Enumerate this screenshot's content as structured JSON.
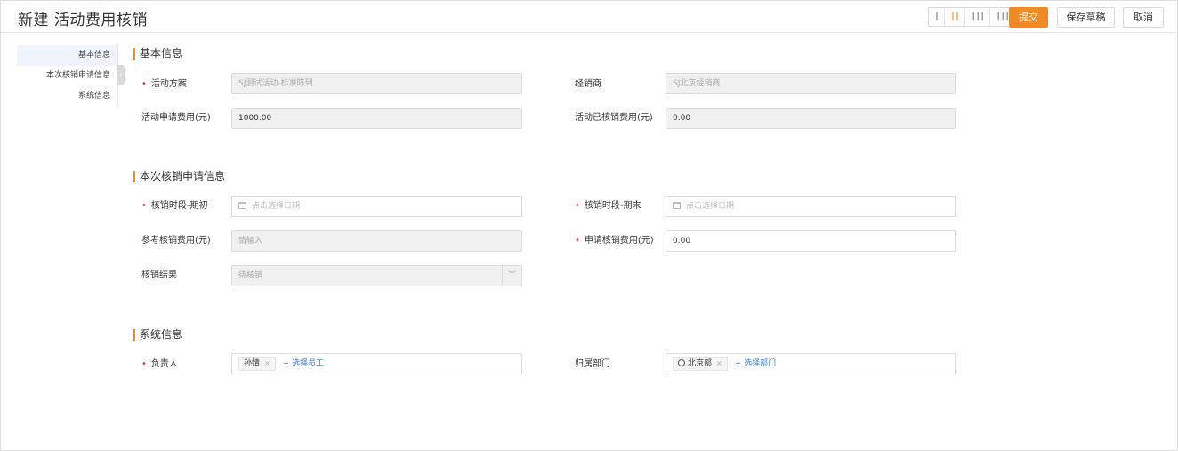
{
  "header": {
    "title": "新建 活动费用核销",
    "layout_options": [
      "|",
      "||",
      "|||",
      "||||"
    ],
    "submit_label": "提交",
    "save_draft_label": "保存草稿",
    "cancel_label": "取消"
  },
  "sidebar": {
    "items": [
      {
        "label": "基本信息"
      },
      {
        "label": "本次核销申请信息"
      },
      {
        "label": "系统信息"
      }
    ]
  },
  "sections": {
    "basic": {
      "title": "基本信息",
      "activity_plan_label": "活动方案",
      "activity_plan_value": "SJ测试活动-标准陈列",
      "dealer_label": "经销商",
      "dealer_value": "SJ北京经销商",
      "apply_fee_label": "活动申请费用(元)",
      "apply_fee_value": "1000.00",
      "written_off_label": "活动已核销费用(元)",
      "written_off_value": "0.00"
    },
    "current": {
      "title": "本次核销申请信息",
      "period_start_label": "核销时段-期初",
      "period_start_placeholder": "点击选择日期",
      "period_end_label": "核销时段-期末",
      "period_end_placeholder": "点击选择日期",
      "ref_fee_label": "参考核销费用(元)",
      "ref_fee_placeholder": "请输入",
      "request_fee_label": "申请核销费用(元)",
      "request_fee_value": "0.00",
      "result_label": "核销结果",
      "result_value": "待核销"
    },
    "system": {
      "title": "系统信息",
      "owner_label": "负责人",
      "owner_tag": "孙婧",
      "owner_add": "+ 选择员工",
      "dept_label": "归属部门",
      "dept_tag": "北京部",
      "dept_add": "+ 选择部门",
      "tag_remove": "×"
    }
  },
  "colors": {
    "accent": "#f08a24",
    "required": "#e53935",
    "link": "#3b7ddd"
  },
  "icons": {
    "required_mark": "•",
    "select_arrow": "﹀",
    "collapse": "‹"
  }
}
